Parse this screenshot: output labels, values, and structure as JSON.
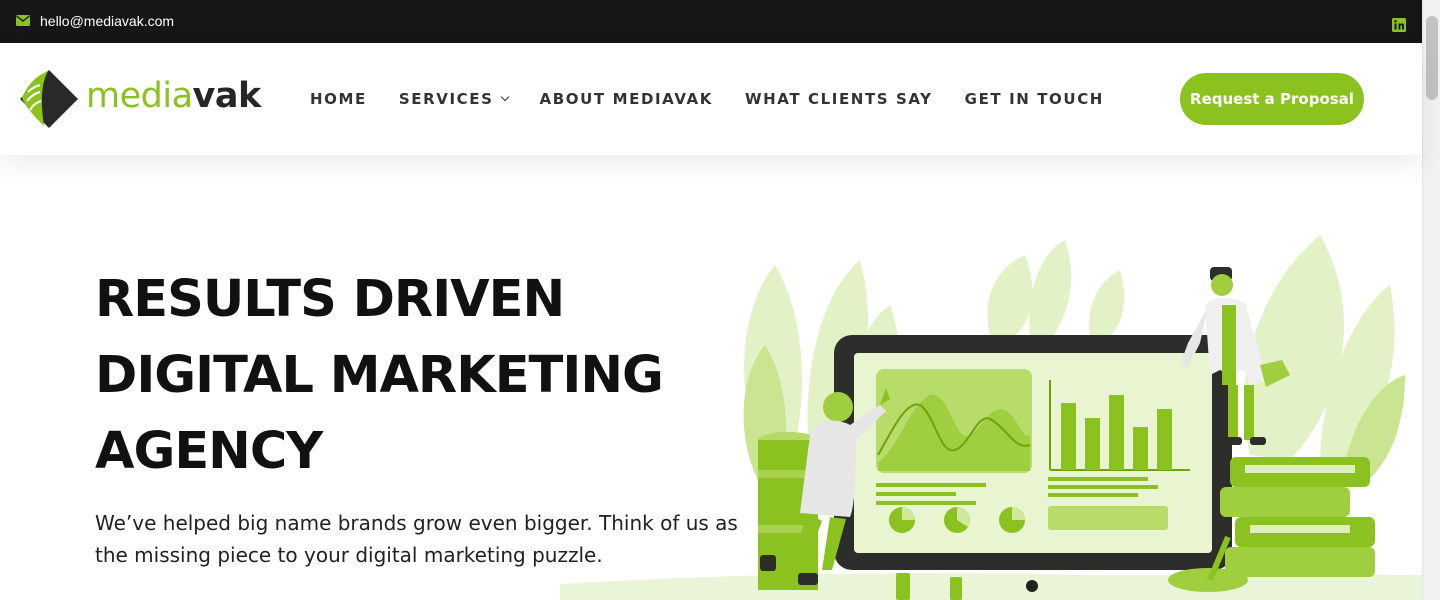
{
  "topbar": {
    "email": "hello@mediavak.com",
    "icons": [
      "envelope-icon",
      "linkedin-icon"
    ]
  },
  "brand": {
    "logo_part1": "media",
    "logo_part2": "vak",
    "accent_color": "#8cc21f",
    "dark_color": "#262626"
  },
  "nav": {
    "items": [
      {
        "label": "HOME"
      },
      {
        "label": "SERVICES",
        "has_dropdown": true
      },
      {
        "label": "ABOUT MEDIAVAK"
      },
      {
        "label": "WHAT CLIENTS SAY"
      },
      {
        "label": "GET IN TOUCH"
      }
    ],
    "cta_label": "Request a Proposal"
  },
  "hero": {
    "title_lines": [
      "RESULTS DRIVEN",
      "DIGITAL MARKETING",
      "AGENCY"
    ],
    "subtitle": "We’ve helped big name brands grow even bigger. Think of us as the missing piece to your digital marketing puzzle."
  },
  "illustration": {
    "bar_chart_values": [
      0.73,
      0.56,
      0.81,
      0.47,
      0.66
    ]
  }
}
